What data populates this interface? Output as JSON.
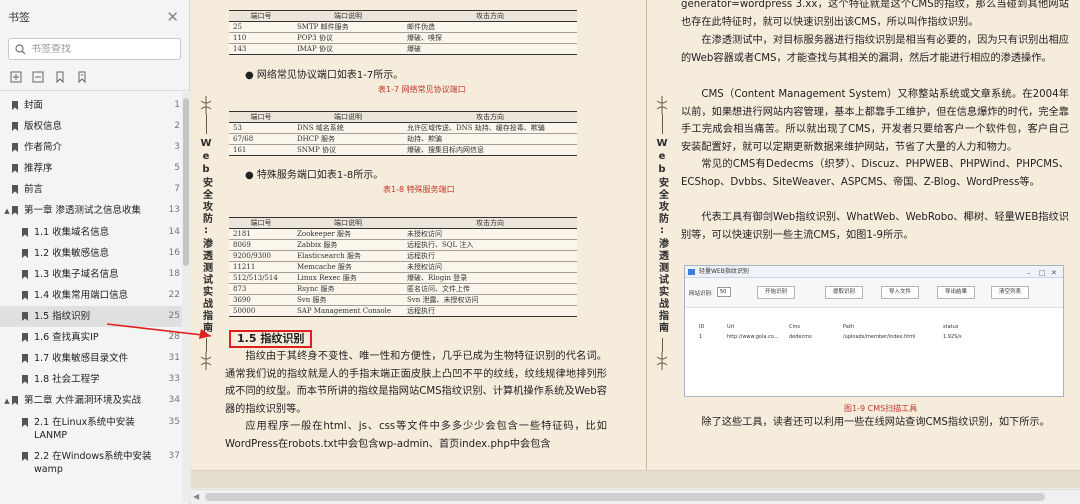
{
  "sidebar": {
    "title": "书签",
    "close_icon": "close-icon",
    "search_placeholder": "书签查找",
    "tools": [
      "expand-all-icon",
      "collapse-all-icon",
      "add-bookmark-icon",
      "bookmark-options-icon"
    ],
    "items": [
      {
        "label": "封面",
        "page": "1",
        "level": 0,
        "caret": ""
      },
      {
        "label": "版权信息",
        "page": "2",
        "level": 0,
        "caret": ""
      },
      {
        "label": "作者简介",
        "page": "3",
        "level": 0,
        "caret": ""
      },
      {
        "label": "推荐序",
        "page": "5",
        "level": 0,
        "caret": ""
      },
      {
        "label": "前言",
        "page": "7",
        "level": 0,
        "caret": ""
      },
      {
        "label": "第一章 渗透测试之信息收集",
        "page": "13",
        "level": 0,
        "caret": "▲"
      },
      {
        "label": "1.1 收集域名信息",
        "page": "14",
        "level": 1,
        "caret": ""
      },
      {
        "label": "1.2 收集敏感信息",
        "page": "16",
        "level": 1,
        "caret": ""
      },
      {
        "label": "1.3 收集子域名信息",
        "page": "18",
        "level": 1,
        "caret": ""
      },
      {
        "label": "1.4 收集常用端口信息",
        "page": "22",
        "level": 1,
        "caret": ""
      },
      {
        "label": "1.5 指纹识别",
        "page": "25",
        "level": 1,
        "caret": "",
        "active": true
      },
      {
        "label": "1.6 查找真实IP",
        "page": "28",
        "level": 1,
        "caret": ""
      },
      {
        "label": "1.7 收集敏感目录文件",
        "page": "31",
        "level": 1,
        "caret": ""
      },
      {
        "label": "1.8 社会工程学",
        "page": "33",
        "level": 1,
        "caret": ""
      },
      {
        "label": "第二章 大件漏洞环境及实战",
        "page": "34",
        "level": 0,
        "caret": "▲"
      },
      {
        "label": "2.1 在Linux系统中安装LANMP",
        "page": "35",
        "level": 1,
        "caret": ""
      },
      {
        "label": "2.2 在Windows系统中安装wamp",
        "page": "37",
        "level": 1,
        "caret": ""
      }
    ]
  },
  "book": {
    "spine_title": "Web安全攻防:渗透测试实战指南",
    "table_top": {
      "headers": [
        "端口号",
        "端口说明",
        "攻击方向"
      ],
      "rows": [
        [
          "25",
          "SMTP 邮件服务",
          "邮件伪造"
        ],
        [
          "110",
          "POP3 协议",
          "爆破、嗅探"
        ],
        [
          "143",
          "IMAP 协议",
          "爆破"
        ]
      ]
    },
    "bullet_1": "● 网络常见协议端口如表1-7所示。",
    "caption_1": "表1-7 网络常见协议端口",
    "table_mid": {
      "headers": [
        "端口号",
        "端口说明",
        "攻击方向"
      ],
      "rows": [
        [
          "53",
          "DNS 域名系统",
          "允许区域传送、DNS 劫持、缓存投毒、欺骗"
        ],
        [
          "67/68",
          "DHCP 服务",
          "劫持、欺骗"
        ],
        [
          "161",
          "SNMP 协议",
          "爆破、搜集目标内网信息"
        ]
      ]
    },
    "bullet_2": "● 特殊服务端口如表1-8所示。",
    "caption_2": "表1-8 特殊服务端口",
    "table_bottom": {
      "headers": [
        "端口号",
        "端口说明",
        "攻击方向"
      ],
      "rows": [
        [
          "2181",
          "Zookeeper 服务",
          "未授权访问"
        ],
        [
          "8069",
          "Zabbix 服务",
          "远程执行、SQL 注入"
        ],
        [
          "9200/9300",
          "Elasticsearch 服务",
          "远程执行"
        ],
        [
          "11211",
          "Memcache 服务",
          "未授权访问"
        ],
        [
          "512/513/514",
          "Linux Rexec 服务",
          "爆破、Rlogin 登录"
        ],
        [
          "873",
          "Rsync 服务",
          "匿名访问、文件上传"
        ],
        [
          "3690",
          "Svn 服务",
          "Svn 泄露、未授权访问"
        ],
        [
          "50000",
          "SAP Management Console",
          "远程执行"
        ]
      ]
    },
    "section_heading": "1.5 指纹识别",
    "left_para_1": "指纹由于其终身不变性、唯一性和方便性，几乎已成为生物特征识别的代名词。通常我们说的指纹就是人的手指末端正面皮肤上凸凹不平的纹线，纹线规律地排列形成不同的纹型。而本节所讲的指纹是指网站CMS指纹识别、计算机操作系统及Web容器的指纹识别等。",
    "left_para_2": "应用程序一般在html、js、css等文件中多多少少会包含一些特征码，比如WordPress在robots.txt中会包含wp-admin、首页index.php中会包含",
    "right_para_0": "generator=wordpress 3.xx，这个特征就是这个CMS的指纹，那么当碰到其他网站也存在此特征时，就可以快速识别出该CMS，所以叫作指纹识别。",
    "right_para_1": "在渗透测试中，对目标服务器进行指纹识别是相当有必要的，因为只有识别出相应的Web容器或者CMS，才能查找与其相关的漏洞，然后才能进行相应的渗透操作。",
    "right_para_2": "CMS（Content Management System）又称整站系统或文章系统。在2004年以前，如果想进行网站内容管理，基本上都靠手工维护，但在信息爆炸的时代，完全靠手工完成会相当痛苦。所以就出现了CMS，开发者只要给客户一个软件包，客户自己安装配置好，就可以定期更新数据来维护网站，节省了大量的人力和物力。",
    "right_para_3": "常见的CMS有Dedecms（织梦）、Discuz、PHPWEB、PHPWind、PHPCMS、ECShop、Dvbbs、SiteWeaver、ASPCMS、帝国、Z-Blog、WordPress等。",
    "right_para_4": "代表工具有御剑Web指纹识别、WhatWeb、WebRobo、椰树、轻量WEB指纹识别等，可以快速识别一些主流CMS，如图1-9所示。",
    "caption_3": "图1-9 CMS扫描工具",
    "right_para_5": "除了这些工具，读者还可以利用一些在线网站查询CMS指纹识别，如下所示。",
    "cms_tool": {
      "title": "轻量WEB指纹识别",
      "thread_label": "网站识别:",
      "thread_value": "50",
      "buttons": [
        "开始识别",
        "提取识别",
        "导入文件",
        "导出结果",
        "清空列表"
      ],
      "columns": [
        "ID",
        "Url",
        "Cms",
        "Path",
        "status"
      ],
      "row": [
        "1",
        "http://www.gola.co...",
        "dedecms",
        "/uploads/member/index.html",
        "1.92S/s"
      ]
    }
  }
}
